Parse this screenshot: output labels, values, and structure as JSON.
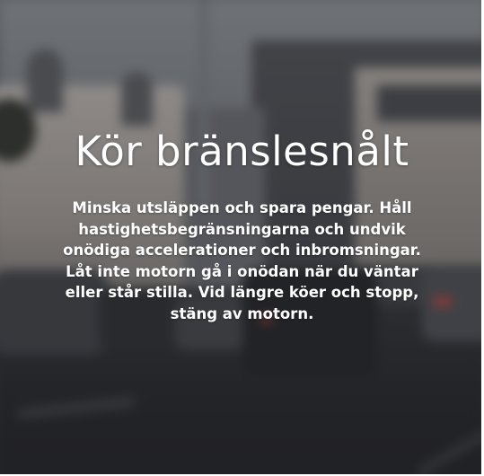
{
  "card": {
    "title": "Kör bränslesnålt",
    "body": "Minska utsläppen och spara pengar. Håll hastighetsbegränsningarna och undvik onödiga accelerationer och inbromsningar. Låt inte motorn gå i onödan när du väntar eller står stilla. Vid längre köer och stopp, stäng av motorn."
  },
  "colors": {
    "text": "#ffffff",
    "overlay": "#14161a"
  }
}
